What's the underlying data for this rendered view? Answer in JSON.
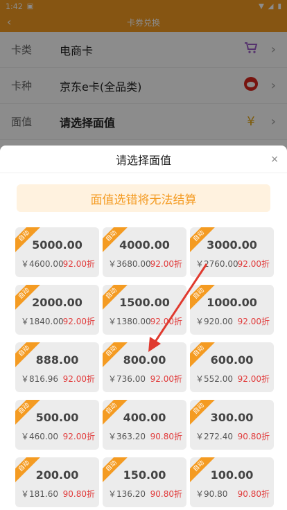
{
  "statusbar": {
    "time": "1:42"
  },
  "appbar": {
    "title": "卡券兑换"
  },
  "form": {
    "rows": [
      {
        "label": "卡类",
        "value": "电商卡",
        "icon": "cart-icon"
      },
      {
        "label": "卡种",
        "value": "京东e卡(全品类)",
        "icon": "jd-logo-icon"
      },
      {
        "label": "面值",
        "value": "请选择面值",
        "icon": "yen-coin-icon"
      }
    ]
  },
  "sheet": {
    "title": "请选择面值",
    "close_label": "×",
    "warning": "面值选错将无法结算",
    "tag": "自动",
    "cards": [
      {
        "amount": "5000.00",
        "price": "￥4600.00",
        "discount": "92.00折"
      },
      {
        "amount": "4000.00",
        "price": "￥3680.00",
        "discount": "92.00折"
      },
      {
        "amount": "3000.00",
        "price": "￥2760.00",
        "discount": "92.00折"
      },
      {
        "amount": "2000.00",
        "price": "￥1840.00",
        "discount": "92.00折"
      },
      {
        "amount": "1500.00",
        "price": "￥1380.00",
        "discount": "92.00折"
      },
      {
        "amount": "1000.00",
        "price": "￥920.00",
        "discount": "92.00折"
      },
      {
        "amount": "888.00",
        "price": "￥816.96",
        "discount": "92.00折"
      },
      {
        "amount": "800.00",
        "price": "￥736.00",
        "discount": "92.00折"
      },
      {
        "amount": "600.00",
        "price": "￥552.00",
        "discount": "92.00折"
      },
      {
        "amount": "500.00",
        "price": "￥460.00",
        "discount": "92.00折"
      },
      {
        "amount": "400.00",
        "price": "￥363.20",
        "discount": "90.80折"
      },
      {
        "amount": "300.00",
        "price": "￥272.40",
        "discount": "90.80折"
      },
      {
        "amount": "200.00",
        "price": "￥181.60",
        "discount": "90.80折"
      },
      {
        "amount": "150.00",
        "price": "￥136.20",
        "discount": "90.80折"
      },
      {
        "amount": "100.00",
        "price": "￥90.80",
        "discount": "90.80折"
      }
    ]
  },
  "colors": {
    "accent": "#f49b22",
    "discount": "#e13b3b",
    "warning_bg": "#fff2df"
  }
}
